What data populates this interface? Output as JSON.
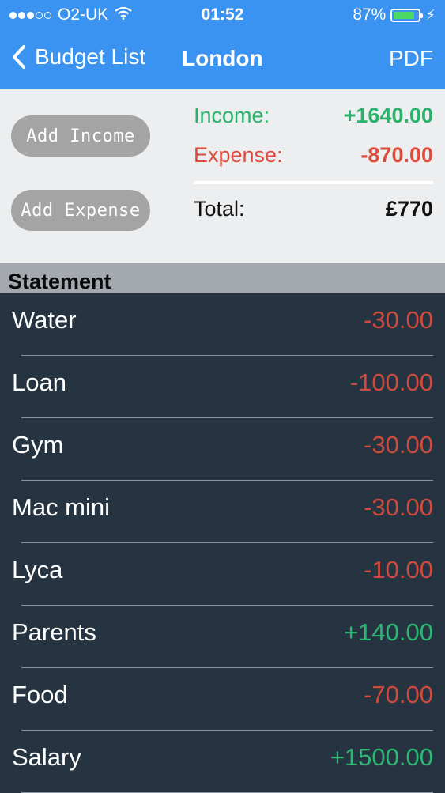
{
  "status": {
    "carrier": "O2-UK",
    "time": "01:52",
    "battery_text": "87%",
    "battery_level": 0.87
  },
  "nav": {
    "back_label": "Budget List",
    "title": "London",
    "pdf_label": "PDF"
  },
  "summary": {
    "add_income_label": "Add Income",
    "add_expense_label": "Add Expense",
    "income_label": "Income:",
    "income_value": "+1640.00",
    "expense_label": "Expense:",
    "expense_value": "-870.00",
    "total_label": "Total:",
    "total_value": "£770"
  },
  "statement": {
    "header": "Statement",
    "items": [
      {
        "name": "Water",
        "amount": "-30.00",
        "type": "expense"
      },
      {
        "name": "Loan",
        "amount": "-100.00",
        "type": "expense"
      },
      {
        "name": "Gym",
        "amount": "-30.00",
        "type": "expense"
      },
      {
        "name": "Mac mini",
        "amount": "-30.00",
        "type": "expense"
      },
      {
        "name": "Lyca",
        "amount": "-10.00",
        "type": "expense"
      },
      {
        "name": "Parents",
        "amount": "+140.00",
        "type": "income"
      },
      {
        "name": "Food",
        "amount": "-70.00",
        "type": "expense"
      },
      {
        "name": "Salary",
        "amount": "+1500.00",
        "type": "income"
      }
    ]
  },
  "colors": {
    "nav_blue": "#3a93f0",
    "income_green": "#27b36a",
    "expense_red": "#e04b3c",
    "list_bg": "#263442",
    "income_list_green": "#2ab873",
    "expense_list_red": "#cf4a3c"
  }
}
